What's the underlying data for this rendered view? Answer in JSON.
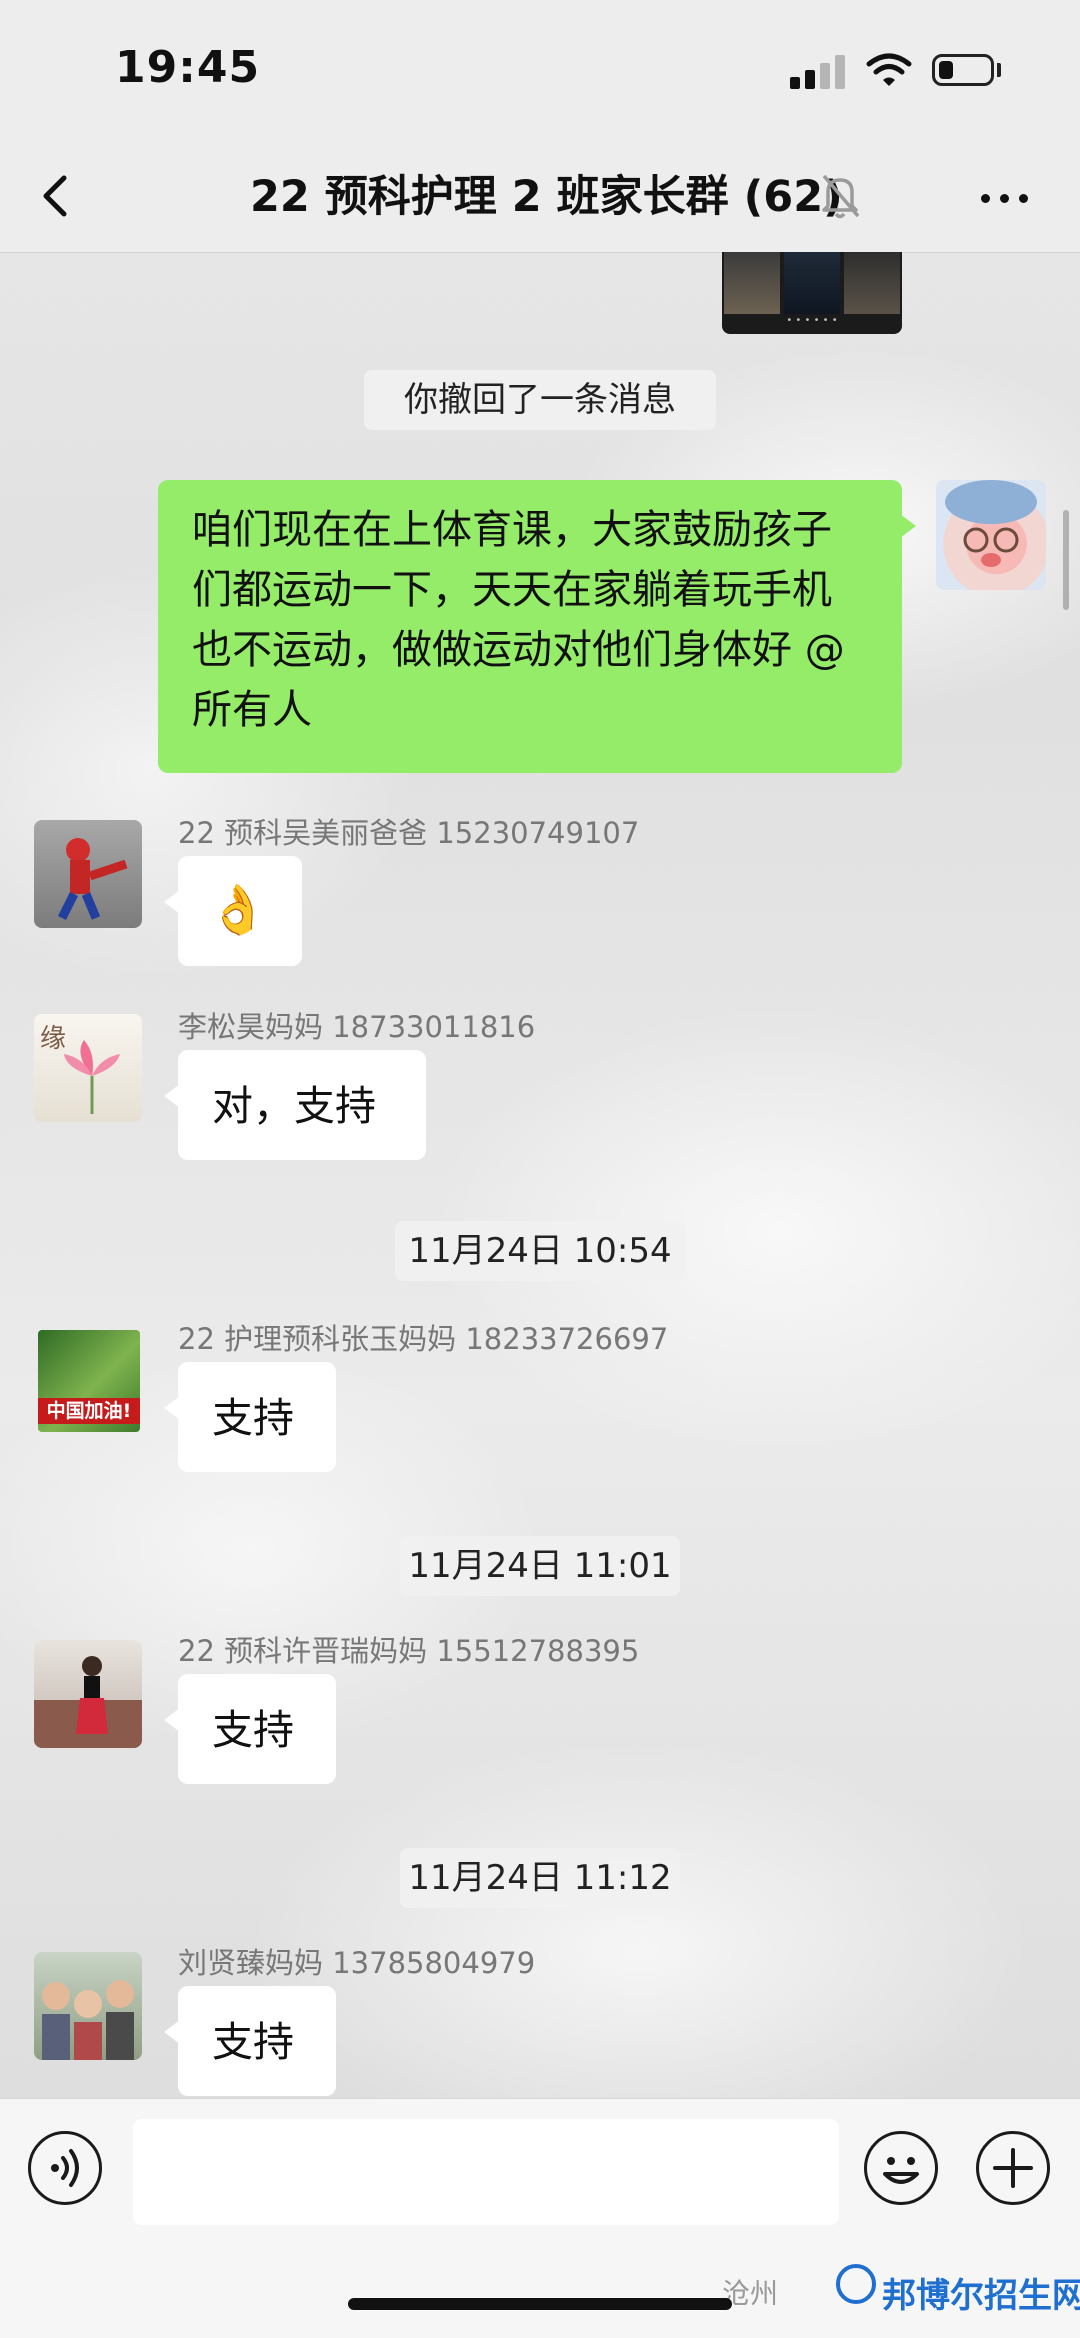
{
  "status_bar": {
    "time": "19:45"
  },
  "header": {
    "title": "22 预科护理 2 班家长群 (62)"
  },
  "system_messages": {
    "recalled": "你撤回了一条消息"
  },
  "own_message": {
    "text": "咱们现在在上体育课，大家鼓励孩子们都运动一下，天天在家躺着玩手机也不运动，做做运动对他们身体好 @所有人"
  },
  "messages": [
    {
      "sender": "22 预科吴美丽爸爸 15230749107",
      "text": "👌"
    },
    {
      "sender": "李松昊妈妈 18733011816",
      "text": "对，支持"
    },
    {
      "timestamp": "11月24日 10:54",
      "sender": "22 护理预科张玉妈妈 18233726697",
      "text": "支持",
      "avatar_caption": "中国加油!"
    },
    {
      "timestamp": "11月24日 11:01",
      "sender": "22 预科许晋瑞妈妈 15512788395",
      "text": "支持"
    },
    {
      "timestamp": "11月24日 11:12",
      "sender": "刘贤臻妈妈 13785804979",
      "text": "支持"
    }
  ],
  "avatar_glyphs": {
    "lotus": "缘"
  },
  "input": {
    "value": ""
  },
  "watermark": {
    "left": "沧州",
    "brand": "邦博尔招生网"
  },
  "icons": [
    "back-icon",
    "mute-bell-icon",
    "more-icon",
    "voice-icon",
    "emoji-icon",
    "add-icon"
  ]
}
